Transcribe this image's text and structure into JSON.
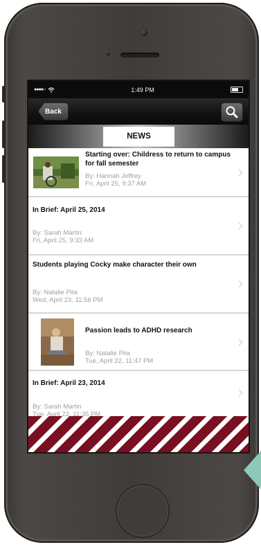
{
  "status_bar": {
    "carrier_signal": "●●●●○",
    "time": "1:49 PM"
  },
  "nav": {
    "back_label": "Back"
  },
  "tab": {
    "label": "NEWS"
  },
  "articles": [
    {
      "title": "Starting over: Childress to return to campus for fall semester",
      "byline": "By: Hannah Jeffrey",
      "date": "Fri, April 25, 9:37 AM"
    },
    {
      "title": "In Brief: April 25, 2014",
      "byline": "By: Sarah Martin",
      "date": "Fri, April 25, 9:33 AM"
    },
    {
      "title": "Students playing Cocky make character their own",
      "byline": "By: Natalie Pita",
      "date": "Wed, April 23, 11:56 PM"
    },
    {
      "title": "Passion leads to ADHD research",
      "byline": "By: Natalie Pita",
      "date": "Tue, April 22, 11:47 PM"
    },
    {
      "title": "In Brief: April 23, 2014",
      "byline": "By: Sarah Martin",
      "date": "Tue, April 22, 11:35 PM"
    }
  ],
  "colors": {
    "garnet": "#7a0f22",
    "teal": "#8ec9b8"
  },
  "icons": [
    "wifi-icon",
    "battery-icon",
    "search-icon",
    "chevron-right-icon",
    "camera",
    "home-button"
  ]
}
